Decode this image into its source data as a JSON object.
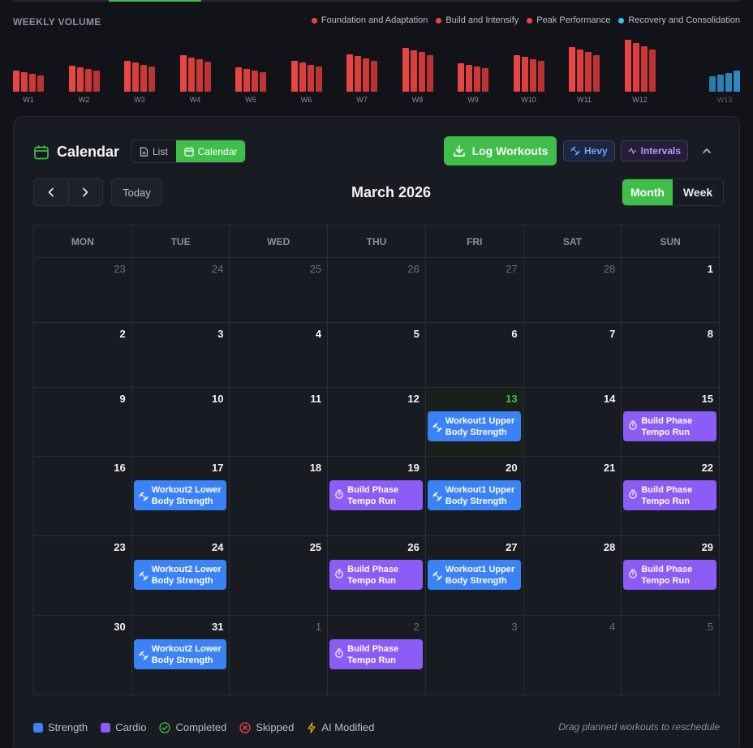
{
  "volume": {
    "title": "WEEKLY VOLUME",
    "legend": [
      {
        "label": "Foundation and Adaptation",
        "color": "#e84545"
      },
      {
        "label": "Build and Intensify",
        "color": "#e84545"
      },
      {
        "label": "Peak Performance",
        "color": "#e84545"
      },
      {
        "label": "Recovery and Consolidation",
        "color": "#38bdf8"
      }
    ],
    "weeks": [
      {
        "label": "W1",
        "values": [
          0.4,
          0.37,
          0.34,
          0.31
        ],
        "color": "red"
      },
      {
        "label": "W2",
        "values": [
          0.5,
          0.47,
          0.43,
          0.4
        ],
        "color": "red"
      },
      {
        "label": "W3",
        "values": [
          0.6,
          0.56,
          0.52,
          0.48
        ],
        "color": "red"
      },
      {
        "label": "W4",
        "values": [
          0.7,
          0.66,
          0.62,
          0.58
        ],
        "color": "red"
      },
      {
        "label": "W5",
        "values": [
          0.47,
          0.44,
          0.41,
          0.38
        ],
        "color": "red"
      },
      {
        "label": "W6",
        "values": [
          0.6,
          0.56,
          0.52,
          0.48
        ],
        "color": "red"
      },
      {
        "label": "W7",
        "values": [
          0.72,
          0.68,
          0.64,
          0.6
        ],
        "color": "red"
      },
      {
        "label": "W8",
        "values": [
          0.84,
          0.8,
          0.76,
          0.71
        ],
        "color": "red"
      },
      {
        "label": "W9",
        "values": [
          0.55,
          0.52,
          0.48,
          0.45
        ],
        "color": "red"
      },
      {
        "label": "W10",
        "values": [
          0.71,
          0.67,
          0.63,
          0.59
        ],
        "color": "red"
      },
      {
        "label": "W11",
        "values": [
          0.86,
          0.81,
          0.76,
          0.71
        ],
        "color": "red"
      },
      {
        "label": "W12",
        "values": [
          1.0,
          0.94,
          0.88,
          0.82
        ],
        "color": "red"
      },
      {
        "label": "W13",
        "values": [
          0.3,
          0.33,
          0.36,
          0.4
        ],
        "color": "blue"
      }
    ]
  },
  "calendar": {
    "title": "Calendar",
    "view_list_label": "List",
    "view_calendar_label": "Calendar",
    "log_button": "Log Workouts",
    "hevy_label": "Hevy",
    "intervals_label": "Intervals",
    "today_label": "Today",
    "month_title": "March 2026",
    "month_label": "Month",
    "week_label": "Week",
    "weekdays": [
      "MON",
      "TUE",
      "WED",
      "THU",
      "FRI",
      "SAT",
      "SUN"
    ],
    "weeks": [
      {
        "days": [
          {
            "num": "23",
            "muted": true
          },
          {
            "num": "24",
            "muted": true
          },
          {
            "num": "25",
            "muted": true
          },
          {
            "num": "26",
            "muted": true
          },
          {
            "num": "27",
            "muted": true
          },
          {
            "num": "28",
            "muted": true
          },
          {
            "num": "1"
          }
        ]
      },
      {
        "days": [
          {
            "num": "2"
          },
          {
            "num": "3"
          },
          {
            "num": "4"
          },
          {
            "num": "5"
          },
          {
            "num": "6"
          },
          {
            "num": "7"
          },
          {
            "num": "8"
          }
        ]
      },
      {
        "days": [
          {
            "num": "9"
          },
          {
            "num": "10"
          },
          {
            "num": "11"
          },
          {
            "num": "12"
          },
          {
            "num": "13",
            "today": true,
            "event": {
              "type": "strength",
              "text": "Workout1 Upper Body Strength"
            }
          },
          {
            "num": "14"
          },
          {
            "num": "15",
            "event": {
              "type": "cardio",
              "text": "Build Phase Tempo Run"
            }
          }
        ]
      },
      {
        "days": [
          {
            "num": "16"
          },
          {
            "num": "17",
            "event": {
              "type": "strength",
              "text": "Workout2 Lower Body Strength"
            }
          },
          {
            "num": "18"
          },
          {
            "num": "19",
            "event": {
              "type": "cardio",
              "text": "Build Phase Tempo Run"
            }
          },
          {
            "num": "20",
            "event": {
              "type": "strength",
              "text": "Workout1 Upper Body Strength"
            }
          },
          {
            "num": "21"
          },
          {
            "num": "22",
            "event": {
              "type": "cardio",
              "text": "Build Phase Tempo Run"
            }
          }
        ]
      },
      {
        "days": [
          {
            "num": "23"
          },
          {
            "num": "24",
            "event": {
              "type": "strength",
              "text": "Workout2 Lower Body Strength"
            }
          },
          {
            "num": "25"
          },
          {
            "num": "26",
            "event": {
              "type": "cardio",
              "text": "Build Phase Tempo Run"
            }
          },
          {
            "num": "27",
            "event": {
              "type": "strength",
              "text": "Workout1 Upper Body Strength"
            }
          },
          {
            "num": "28"
          },
          {
            "num": "29",
            "event": {
              "type": "cardio",
              "text": "Build Phase Tempo Run"
            }
          }
        ]
      },
      {
        "days": [
          {
            "num": "30"
          },
          {
            "num": "31",
            "event": {
              "type": "strength",
              "text": "Workout2 Lower Body Strength"
            }
          },
          {
            "num": "1",
            "muted": true
          },
          {
            "num": "2",
            "muted": true,
            "event": {
              "type": "cardio",
              "text": "Build Phase Tempo Run"
            }
          },
          {
            "num": "3",
            "muted": true
          },
          {
            "num": "4",
            "muted": true
          },
          {
            "num": "5",
            "muted": true
          }
        ]
      }
    ],
    "legend": {
      "strength": "Strength",
      "cardio": "Cardio",
      "completed": "Completed",
      "skipped": "Skipped",
      "ai_modified": "AI Modified"
    },
    "hint": "Drag planned workouts to reschedule"
  },
  "colors": {
    "accent": "#3fbf4a",
    "strength": "#3b82f6",
    "cardio": "#8b5cf6",
    "volume_red": "#e84545",
    "volume_blue": "#2c7fb0"
  }
}
